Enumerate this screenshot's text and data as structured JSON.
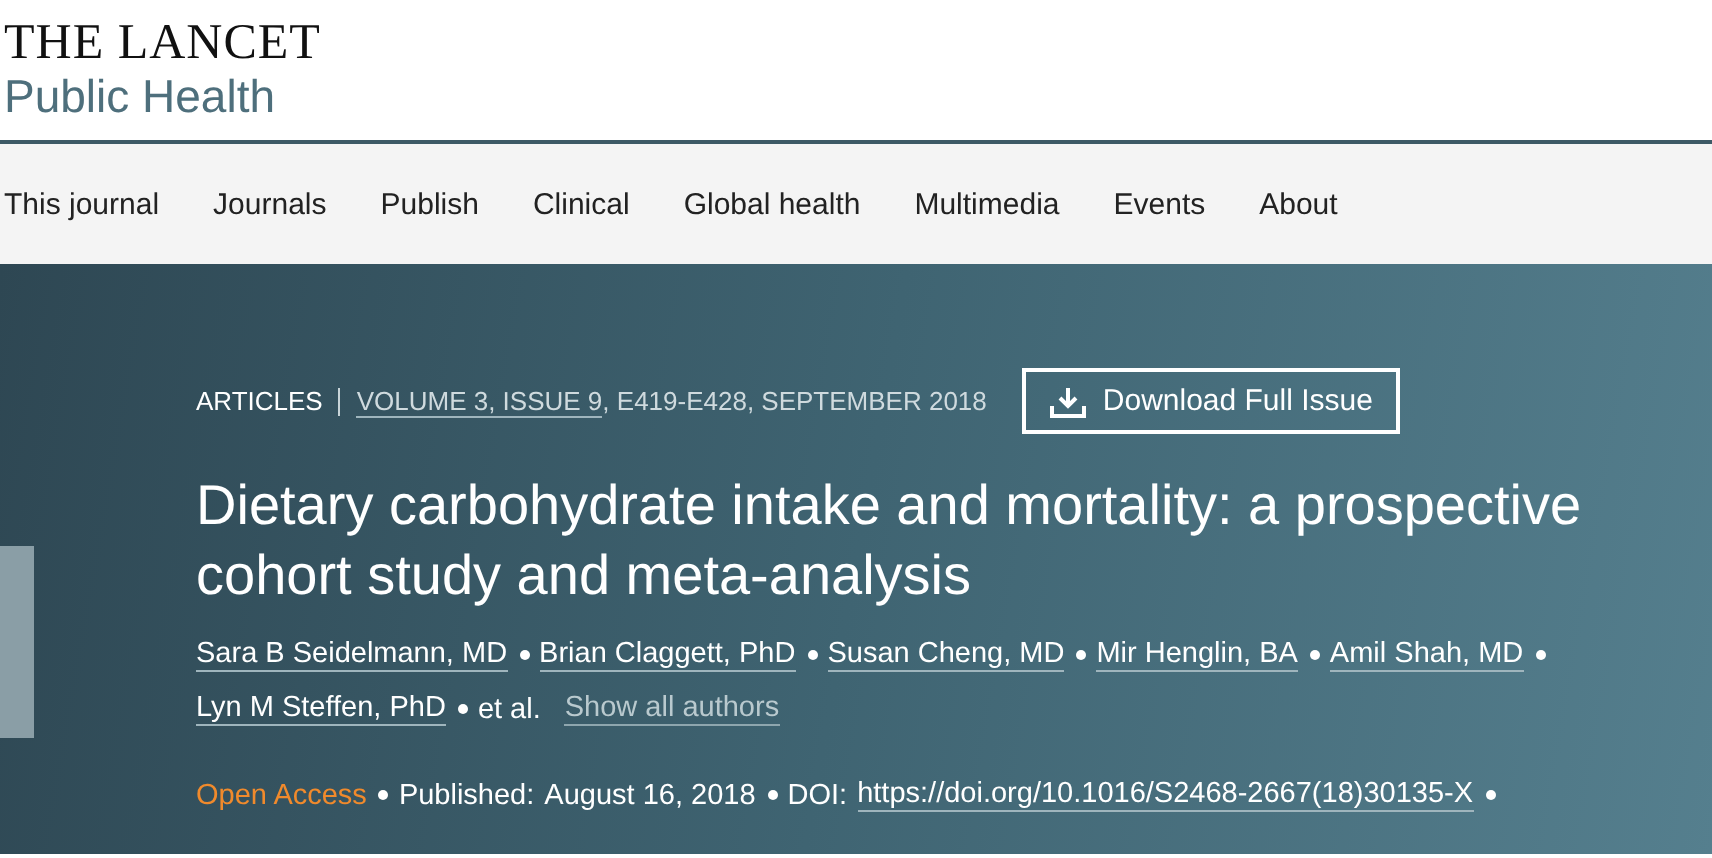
{
  "logo": {
    "title": "THE LANCET",
    "subtitle": "Public Health"
  },
  "nav": {
    "items": [
      {
        "label": "This journal"
      },
      {
        "label": "Journals"
      },
      {
        "label": "Publish"
      },
      {
        "label": "Clinical"
      },
      {
        "label": "Global health"
      },
      {
        "label": "Multimedia"
      },
      {
        "label": "Events"
      },
      {
        "label": "About"
      }
    ]
  },
  "article": {
    "type": "ARTICLES",
    "issue_link": "VOLUME 3, ISSUE 9",
    "issue_rest": ", E419-E428, SEPTEMBER 2018",
    "download_button": "Download Full Issue",
    "title": "Dietary carbohydrate intake and mortality: a prospective cohort study and meta-analysis",
    "authors": [
      "Sara B Seidelmann, MD",
      "Brian Claggett, PhD",
      "Susan Cheng, MD",
      "Mir Henglin, BA",
      "Amil Shah, MD",
      "Lyn M Steffen, PhD"
    ],
    "et_al": "et al.",
    "show_all": "Show all authors",
    "access": "Open Access",
    "published_label": "Published:",
    "published_date": "August 16, 2018",
    "doi_label": "DOI:",
    "doi": "https://doi.org/10.1016/S2468-2667(18)30135-X"
  }
}
